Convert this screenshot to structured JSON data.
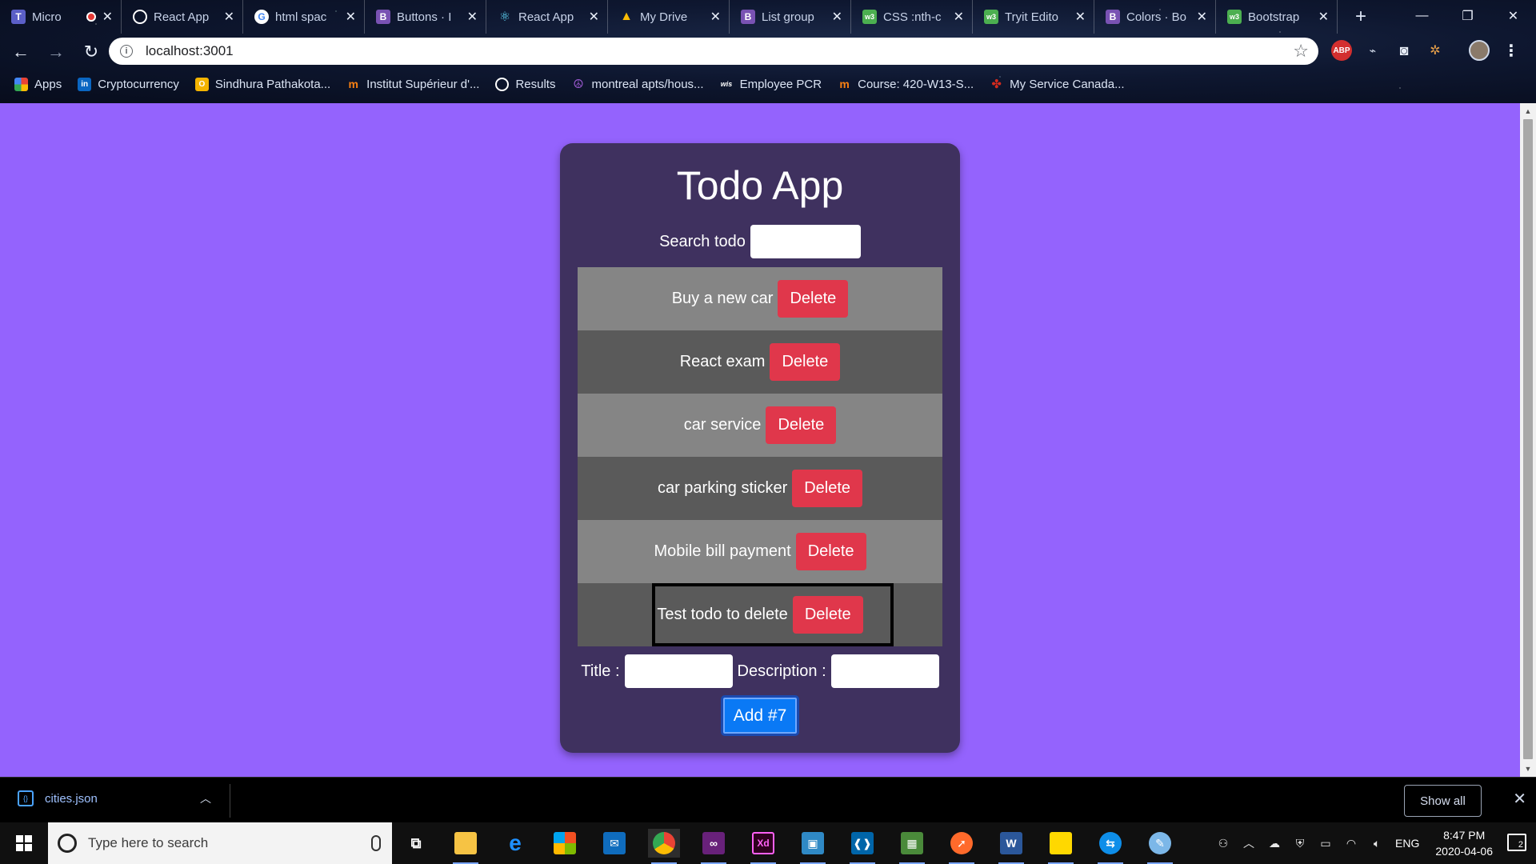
{
  "browser": {
    "tabs": [
      {
        "title": "Micro",
        "favicon": "teams-icon",
        "color": "#5b5fc7"
      },
      {
        "title": "React App",
        "favicon": "globe-icon",
        "color": "#ffffff"
      },
      {
        "title": "html spac",
        "favicon": "google-icon",
        "color": "#ffffff"
      },
      {
        "title": "Buttons · I",
        "favicon": "bootstrap-icon",
        "color": "#7952b3"
      },
      {
        "title": "React App",
        "favicon": "react-icon",
        "color": "#61dafb"
      },
      {
        "title": "My Drive",
        "favicon": "drive-icon",
        "color": "#1fa463"
      },
      {
        "title": "List group",
        "favicon": "bootstrap-icon",
        "color": "#7952b3"
      },
      {
        "title": "CSS :nth-c",
        "favicon": "w3schools-icon",
        "color": "#4caf50"
      },
      {
        "title": "Tryit Edito",
        "favicon": "w3schools-icon",
        "color": "#4caf50"
      },
      {
        "title": "Colors · Bo",
        "favicon": "bootstrap-icon",
        "color": "#7952b3"
      },
      {
        "title": "Bootstrap",
        "favicon": "w3schools-icon",
        "color": "#4caf50"
      }
    ],
    "url": "localhost:3001",
    "bookmarks": [
      {
        "label": "Apps",
        "icon": "apps-grid-icon",
        "color": "#ea4335"
      },
      {
        "label": "Cryptocurrency",
        "icon": "linkedin-icon",
        "color": "#0a66c2"
      },
      {
        "label": "Sindhura Pathakota...",
        "icon": "bookmark-o-icon",
        "color": "#f4b400"
      },
      {
        "label": "Institut Supérieur d'...",
        "icon": "moodle-icon",
        "color": "#f98012"
      },
      {
        "label": "Results",
        "icon": "globe-icon",
        "color": "#ffffff"
      },
      {
        "label": "montreal apts/hous...",
        "icon": "peace-icon",
        "color": "#7b3fbf"
      },
      {
        "label": "Employee PCR",
        "icon": "wis-icon",
        "color": "#ffffff"
      },
      {
        "label": "Course: 420-W13-S...",
        "icon": "moodle-icon",
        "color": "#f98012"
      },
      {
        "label": "My Service Canada...",
        "icon": "maple-leaf-icon",
        "color": "#d52b1e"
      }
    ],
    "extensions": {
      "abp": "ABP"
    }
  },
  "app": {
    "title": "Todo App",
    "search_label": "Search todo",
    "search_value": "",
    "todos": [
      {
        "title": "Buy a new car",
        "delete_label": "Delete"
      },
      {
        "title": "React exam",
        "delete_label": "Delete"
      },
      {
        "title": "car service",
        "delete_label": "Delete"
      },
      {
        "title": "car parking sticker",
        "delete_label": "Delete"
      },
      {
        "title": "Mobile bill payment",
        "delete_label": "Delete"
      },
      {
        "title": "Test todo to delete",
        "delete_label": "Delete"
      }
    ],
    "title_label": "Title :",
    "description_label": "Description :",
    "add_label": "Add #7",
    "colors": {
      "background": "#9463fd",
      "card": "#3f315f",
      "row_light": "#858585",
      "row_dark": "#5a5a5a",
      "delete": "#e0374b",
      "add": "#0a79f5"
    }
  },
  "downloads": {
    "file": "cities.json",
    "show_all": "Show all"
  },
  "taskbar": {
    "search_placeholder": "Type here to search",
    "language": "ENG",
    "time": "8:47 PM",
    "date": "2020-04-06",
    "notification_count": "2"
  }
}
